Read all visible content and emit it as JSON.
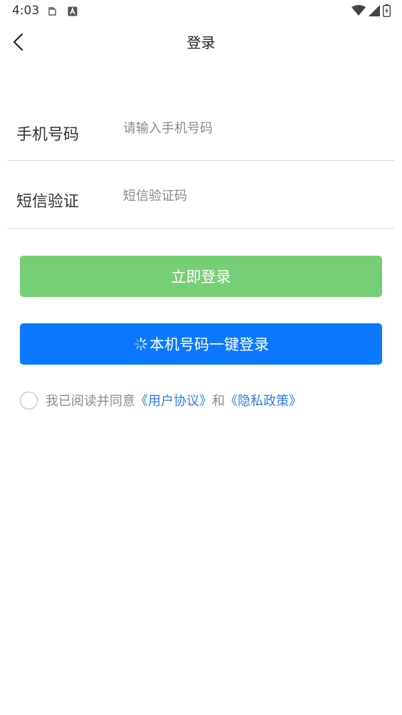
{
  "status_bar": {
    "time": "4:03",
    "icons": [
      "clipboard-icon",
      "a-badge-icon",
      "wifi-icon",
      "signal-icon",
      "battery-charging-icon"
    ]
  },
  "nav": {
    "title": "登录",
    "back_icon": "chevron-left-icon"
  },
  "form": {
    "phone": {
      "label": "手机号码",
      "placeholder": "请输入手机号码",
      "value": ""
    },
    "sms": {
      "label": "短信验证",
      "placeholder": "短信验证码",
      "value": ""
    }
  },
  "buttons": {
    "login": "立即登录",
    "one_click": "本机号码一键登录",
    "one_click_icon": "spinner-icon"
  },
  "agreement": {
    "checked": false,
    "prefix": "我已阅读并同意",
    "user_agreement": "《用户协议》",
    "conjunction": "和",
    "privacy_policy": "《隐私政策》"
  },
  "colors": {
    "login_button": "#77cf75",
    "one_click_button": "#0b79ff",
    "link": "#2f7be8",
    "divider": "#d9d9d9"
  }
}
